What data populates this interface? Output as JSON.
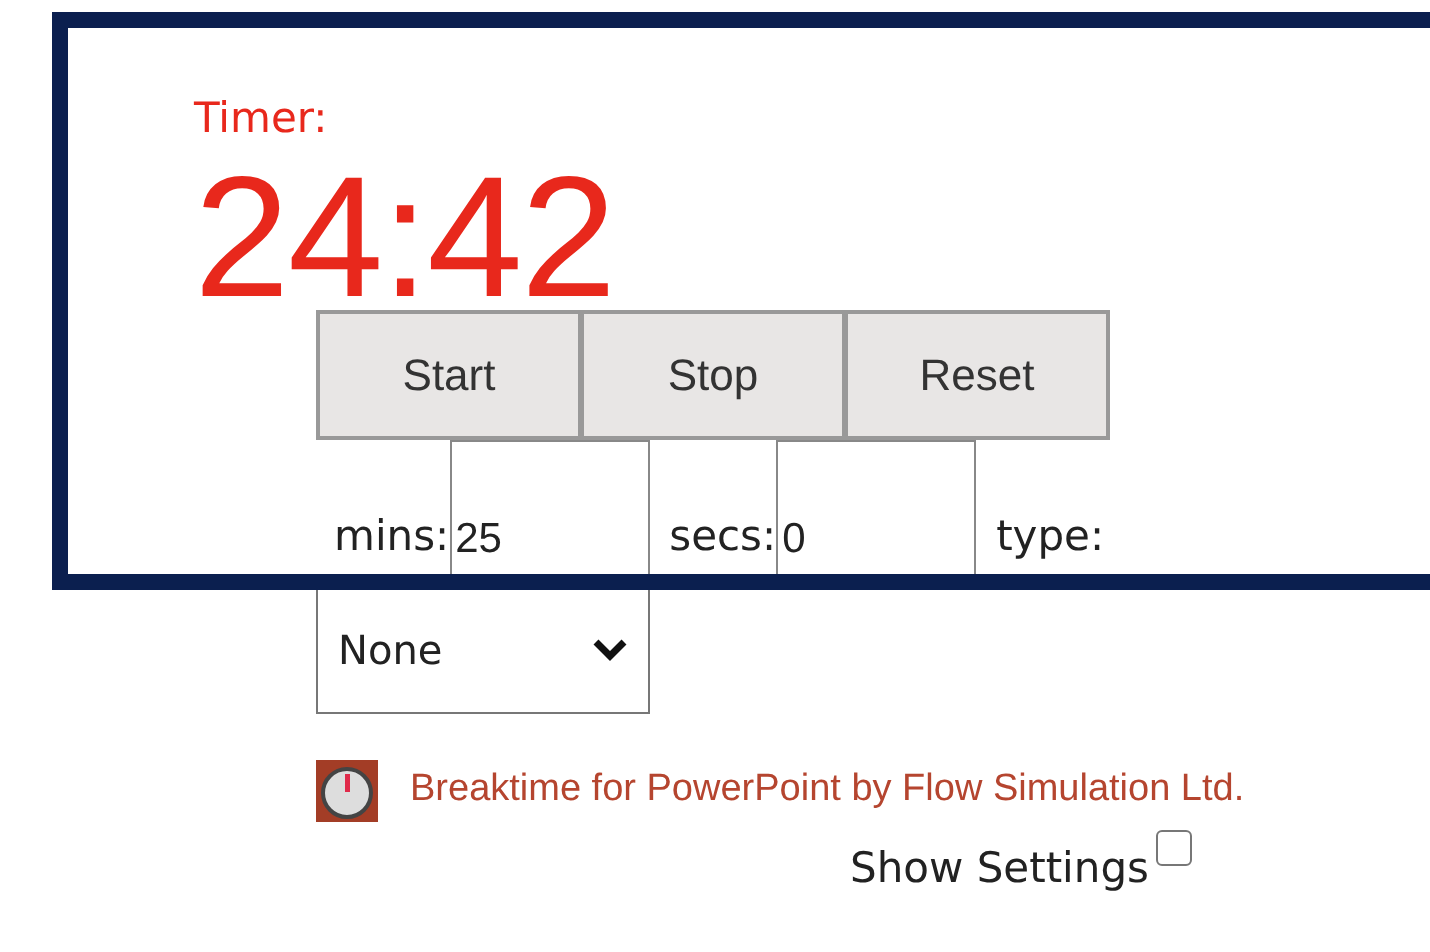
{
  "timer": {
    "label": "Timer:",
    "time": "24:42"
  },
  "buttons": [
    "Start",
    "Stop",
    "Reset"
  ],
  "fields": [
    {
      "label": "mins:",
      "value": "25"
    },
    {
      "label": "secs:",
      "value": "0"
    }
  ],
  "type": {
    "label": "type:",
    "value": "None"
  },
  "credit": "Breaktime for PowerPoint by Flow Simulation Ltd.",
  "show_settings": {
    "label": "Show Settings",
    "checked": false
  }
}
